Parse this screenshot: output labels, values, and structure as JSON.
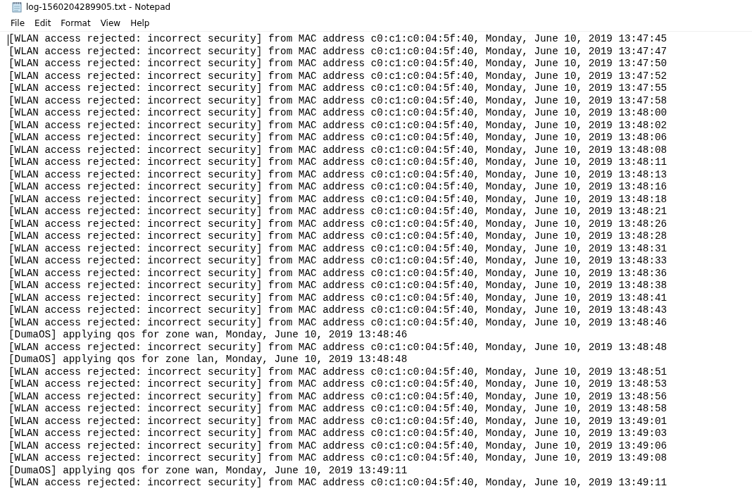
{
  "window": {
    "title": "log-1560204289905.txt - Notepad"
  },
  "menu": [
    "File",
    "Edit",
    "Format",
    "View",
    "Help"
  ],
  "editor": {
    "caret_at_start": true,
    "lines": [
      "[WLAN access rejected: incorrect security] from MAC address c0:c1:c0:04:5f:40, Monday, June 10, 2019 13:47:45",
      "[WLAN access rejected: incorrect security] from MAC address c0:c1:c0:04:5f:40, Monday, June 10, 2019 13:47:47",
      "[WLAN access rejected: incorrect security] from MAC address c0:c1:c0:04:5f:40, Monday, June 10, 2019 13:47:50",
      "[WLAN access rejected: incorrect security] from MAC address c0:c1:c0:04:5f:40, Monday, June 10, 2019 13:47:52",
      "[WLAN access rejected: incorrect security] from MAC address c0:c1:c0:04:5f:40, Monday, June 10, 2019 13:47:55",
      "[WLAN access rejected: incorrect security] from MAC address c0:c1:c0:04:5f:40, Monday, June 10, 2019 13:47:58",
      "[WLAN access rejected: incorrect security] from MAC address c0:c1:c0:04:5f:40, Monday, June 10, 2019 13:48:00",
      "[WLAN access rejected: incorrect security] from MAC address c0:c1:c0:04:5f:40, Monday, June 10, 2019 13:48:02",
      "[WLAN access rejected: incorrect security] from MAC address c0:c1:c0:04:5f:40, Monday, June 10, 2019 13:48:06",
      "[WLAN access rejected: incorrect security] from MAC address c0:c1:c0:04:5f:40, Monday, June 10, 2019 13:48:08",
      "[WLAN access rejected: incorrect security] from MAC address c0:c1:c0:04:5f:40, Monday, June 10, 2019 13:48:11",
      "[WLAN access rejected: incorrect security] from MAC address c0:c1:c0:04:5f:40, Monday, June 10, 2019 13:48:13",
      "[WLAN access rejected: incorrect security] from MAC address c0:c1:c0:04:5f:40, Monday, June 10, 2019 13:48:16",
      "[WLAN access rejected: incorrect security] from MAC address c0:c1:c0:04:5f:40, Monday, June 10, 2019 13:48:18",
      "[WLAN access rejected: incorrect security] from MAC address c0:c1:c0:04:5f:40, Monday, June 10, 2019 13:48:21",
      "[WLAN access rejected: incorrect security] from MAC address c0:c1:c0:04:5f:40, Monday, June 10, 2019 13:48:26",
      "[WLAN access rejected: incorrect security] from MAC address c0:c1:c0:04:5f:40, Monday, June 10, 2019 13:48:28",
      "[WLAN access rejected: incorrect security] from MAC address c0:c1:c0:04:5f:40, Monday, June 10, 2019 13:48:31",
      "[WLAN access rejected: incorrect security] from MAC address c0:c1:c0:04:5f:40, Monday, June 10, 2019 13:48:33",
      "[WLAN access rejected: incorrect security] from MAC address c0:c1:c0:04:5f:40, Monday, June 10, 2019 13:48:36",
      "[WLAN access rejected: incorrect security] from MAC address c0:c1:c0:04:5f:40, Monday, June 10, 2019 13:48:38",
      "[WLAN access rejected: incorrect security] from MAC address c0:c1:c0:04:5f:40, Monday, June 10, 2019 13:48:41",
      "[WLAN access rejected: incorrect security] from MAC address c0:c1:c0:04:5f:40, Monday, June 10, 2019 13:48:43",
      "[WLAN access rejected: incorrect security] from MAC address c0:c1:c0:04:5f:40, Monday, June 10, 2019 13:48:46",
      "[DumaOS] applying qos for zone wan, Monday, June 10, 2019 13:48:46",
      "[WLAN access rejected: incorrect security] from MAC address c0:c1:c0:04:5f:40, Monday, June 10, 2019 13:48:48",
      "[DumaOS] applying qos for zone lan, Monday, June 10, 2019 13:48:48",
      "[WLAN access rejected: incorrect security] from MAC address c0:c1:c0:04:5f:40, Monday, June 10, 2019 13:48:51",
      "[WLAN access rejected: incorrect security] from MAC address c0:c1:c0:04:5f:40, Monday, June 10, 2019 13:48:53",
      "[WLAN access rejected: incorrect security] from MAC address c0:c1:c0:04:5f:40, Monday, June 10, 2019 13:48:56",
      "[WLAN access rejected: incorrect security] from MAC address c0:c1:c0:04:5f:40, Monday, June 10, 2019 13:48:58",
      "[WLAN access rejected: incorrect security] from MAC address c0:c1:c0:04:5f:40, Monday, June 10, 2019 13:49:01",
      "[WLAN access rejected: incorrect security] from MAC address c0:c1:c0:04:5f:40, Monday, June 10, 2019 13:49:03",
      "[WLAN access rejected: incorrect security] from MAC address c0:c1:c0:04:5f:40, Monday, June 10, 2019 13:49:06",
      "[WLAN access rejected: incorrect security] from MAC address c0:c1:c0:04:5f:40, Monday, June 10, 2019 13:49:08",
      "[DumaOS] applying qos for zone wan, Monday, June 10, 2019 13:49:11",
      "[WLAN access rejected: incorrect security] from MAC address c0:c1:c0:04:5f:40, Monday, June 10, 2019 13:49:11"
    ]
  }
}
